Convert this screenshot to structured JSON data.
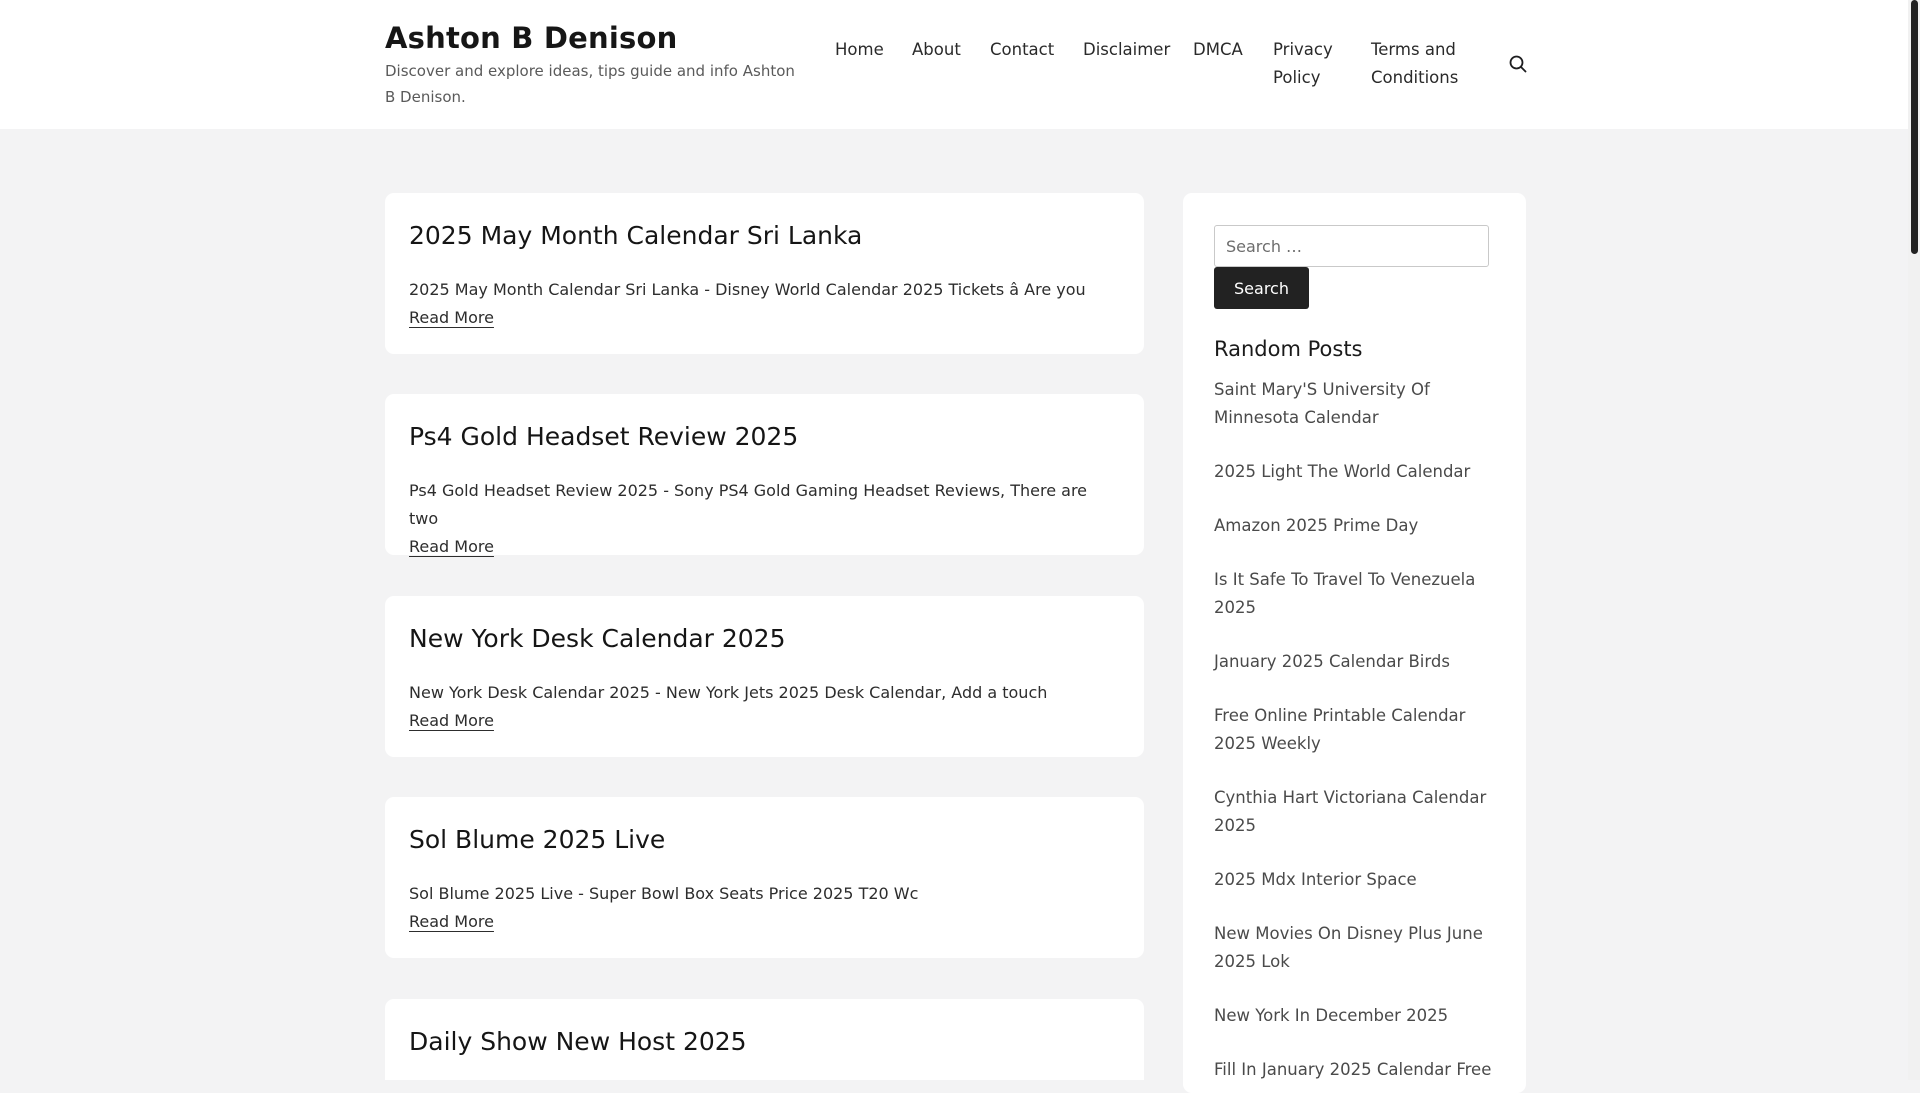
{
  "header": {
    "site_title": "Ashton B Denison",
    "site_description": "Discover and explore ideas, tips guide and info Ashton B Denison."
  },
  "nav": {
    "items": [
      {
        "label": "Home"
      },
      {
        "label": "About"
      },
      {
        "label": "Contact"
      },
      {
        "label": "Disclaimer"
      },
      {
        "label": "DMCA"
      },
      {
        "label": "Privacy Policy"
      },
      {
        "label": "Terms and Conditions"
      }
    ],
    "search_icon": "search-icon"
  },
  "posts": [
    {
      "title": "2025 May Month Calendar Sri Lanka",
      "excerpt": "2025 May Month Calendar Sri Lanka - Disney World Calendar 2025 Tickets â Are you",
      "read_more": "Read More"
    },
    {
      "title": "Ps4 Gold Headset Review 2025",
      "excerpt": "Ps4 Gold Headset Review 2025 - Sony PS4 Gold Gaming Headset Reviews, There are two",
      "read_more": "Read More"
    },
    {
      "title": "New York Desk Calendar 2025",
      "excerpt": "New York Desk Calendar 2025 - New York Jets 2025 Desk Calendar, Add a touch",
      "read_more": "Read More"
    },
    {
      "title": "Sol Blume 2025 Live",
      "excerpt": "Sol Blume 2025 Live - Super Bowl Box Seats Price 2025 T20 Wc",
      "read_more": "Read More"
    },
    {
      "title": "Daily Show New Host 2025",
      "excerpt": "",
      "read_more": ""
    }
  ],
  "sidebar": {
    "search_placeholder": "Search …",
    "search_button": "Search",
    "random_title": "Random Posts",
    "random_posts": [
      "Saint Mary'S University Of Minnesota Calendar",
      "2025 Light The World Calendar",
      "Amazon 2025 Prime Day",
      "Is It Safe To Travel To Venezuela 2025",
      "January 2025 Calendar Birds",
      "Free Online Printable Calendar 2025 Weekly",
      "Cynthia Hart Victoriana Calendar 2025",
      "2025 Mdx Interior Space",
      "New Movies On Disney Plus June 2025 Lok",
      "New York In December 2025",
      "Fill In January 2025 Calendar Free"
    ]
  }
}
